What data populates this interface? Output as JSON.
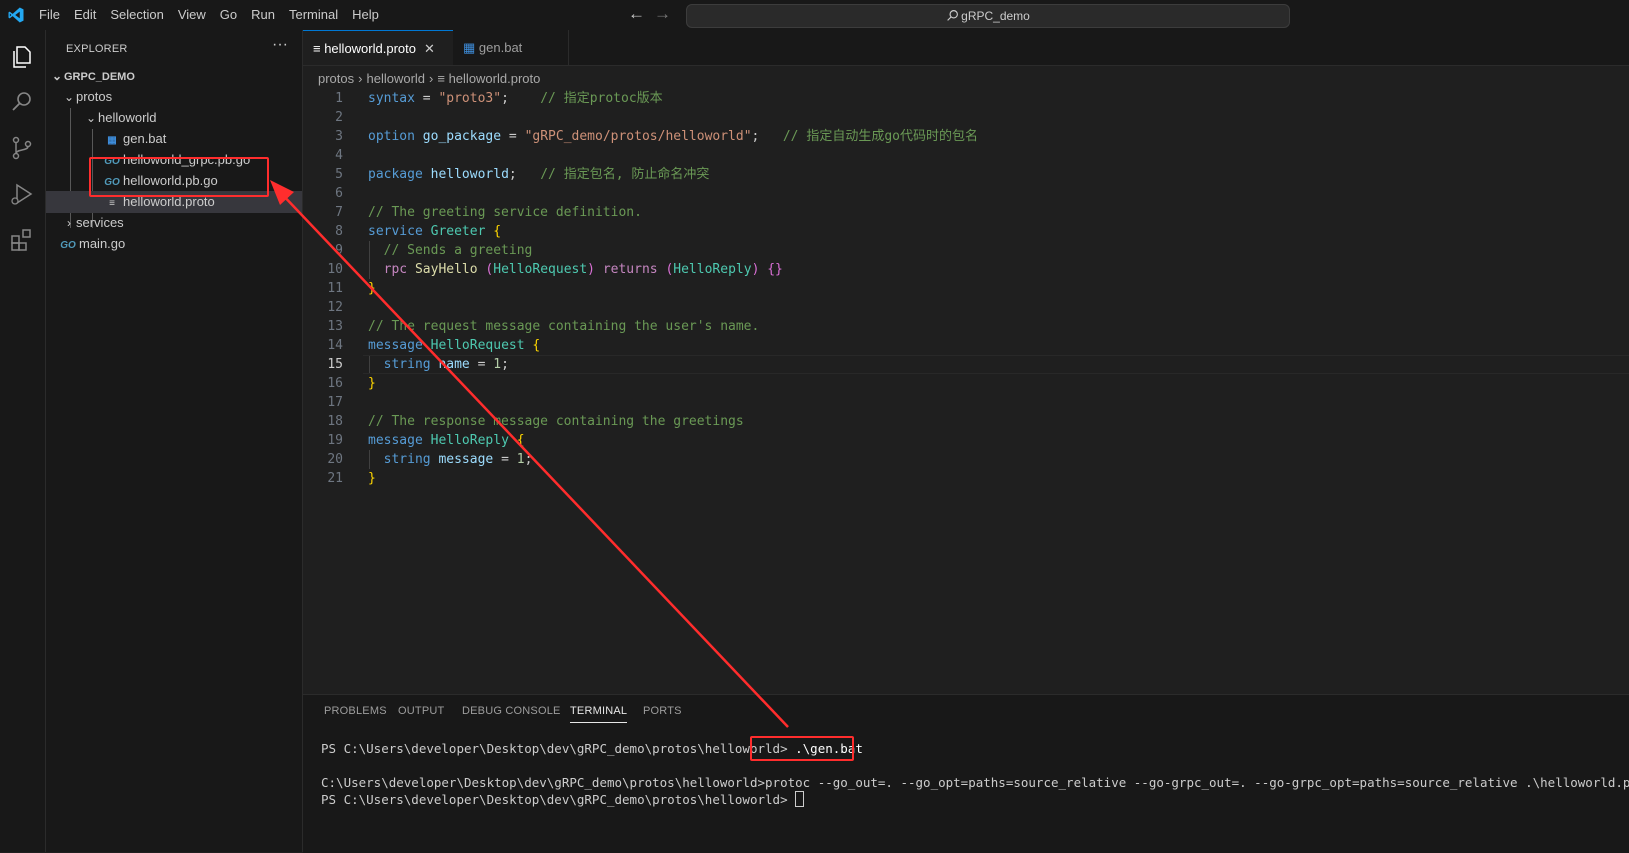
{
  "menu": [
    "File",
    "Edit",
    "Selection",
    "View",
    "Go",
    "Run",
    "Terminal",
    "Help"
  ],
  "search": {
    "text": "gRPC_demo"
  },
  "explorer": {
    "title": "EXPLORER",
    "more_label": "···",
    "tree": [
      {
        "label": "GRPC_DEMO",
        "type": "root",
        "expanded": true,
        "depth": 0
      },
      {
        "label": "protos",
        "type": "folder",
        "expanded": true,
        "depth": 1
      },
      {
        "label": "helloworld",
        "type": "folder",
        "expanded": true,
        "depth": 2
      },
      {
        "label": "gen.bat",
        "type": "bat",
        "depth": 3
      },
      {
        "label": "helloworld_grpc.pb.go",
        "type": "go",
        "depth": 3
      },
      {
        "label": "helloworld.pb.go",
        "type": "go",
        "depth": 3
      },
      {
        "label": "helloworld.proto",
        "type": "proto",
        "depth": 3,
        "selected": true
      },
      {
        "label": "services",
        "type": "folder",
        "expanded": false,
        "depth": 1
      },
      {
        "label": "main.go",
        "type": "go",
        "depth": 1
      }
    ]
  },
  "tabs": [
    {
      "label": "helloworld.proto",
      "active": true,
      "close": "✕"
    },
    {
      "label": "gen.bat",
      "active": false
    }
  ],
  "breadcrumb": [
    "protos",
    "helloworld",
    "helloworld.proto"
  ],
  "editor": {
    "current_line": 15,
    "lines": [
      {
        "n": "1",
        "tokens": [
          [
            "kw2",
            "syntax"
          ],
          [
            "plain",
            " = "
          ],
          [
            "str",
            "\"proto3\""
          ],
          [
            "plain",
            ";    "
          ],
          [
            "cmt",
            "// 指定protoc版本"
          ]
        ]
      },
      {
        "n": "2",
        "tokens": []
      },
      {
        "n": "3",
        "tokens": [
          [
            "kw2",
            "option"
          ],
          [
            "plain",
            " "
          ],
          [
            "var",
            "go_package"
          ],
          [
            "plain",
            " = "
          ],
          [
            "str",
            "\"gRPC_demo/protos/helloworld\""
          ],
          [
            "plain",
            ";   "
          ],
          [
            "cmt",
            "// 指定自动生成go代码时的包名"
          ]
        ]
      },
      {
        "n": "4",
        "tokens": []
      },
      {
        "n": "5",
        "tokens": [
          [
            "kw2",
            "package"
          ],
          [
            "plain",
            " "
          ],
          [
            "var",
            "helloworld"
          ],
          [
            "plain",
            ";   "
          ],
          [
            "cmt",
            "// 指定包名, 防止命名冲突"
          ]
        ]
      },
      {
        "n": "6",
        "tokens": []
      },
      {
        "n": "7",
        "tokens": [
          [
            "cmt",
            "// The greeting service definition."
          ]
        ]
      },
      {
        "n": "8",
        "tokens": [
          [
            "kw2",
            "service"
          ],
          [
            "plain",
            " "
          ],
          [
            "ty",
            "Greeter"
          ],
          [
            "plain",
            " "
          ],
          [
            "br1",
            "{"
          ]
        ]
      },
      {
        "n": "9",
        "tokens": [
          [
            "plain",
            "  "
          ],
          [
            "cmt",
            "// Sends a greeting"
          ]
        ]
      },
      {
        "n": "10",
        "tokens": [
          [
            "plain",
            "  "
          ],
          [
            "kw",
            "rpc"
          ],
          [
            "plain",
            " "
          ],
          [
            "fn",
            "SayHello"
          ],
          [
            "plain",
            " "
          ],
          [
            "br2",
            "("
          ],
          [
            "ty",
            "HelloRequest"
          ],
          [
            "br2",
            ")"
          ],
          [
            "plain",
            " "
          ],
          [
            "kw",
            "returns"
          ],
          [
            "plain",
            " "
          ],
          [
            "br2",
            "("
          ],
          [
            "ty",
            "HelloReply"
          ],
          [
            "br2",
            ")"
          ],
          [
            "plain",
            " "
          ],
          [
            "br2",
            "{}"
          ]
        ]
      },
      {
        "n": "11",
        "tokens": [
          [
            "br1",
            "}"
          ]
        ]
      },
      {
        "n": "12",
        "tokens": []
      },
      {
        "n": "13",
        "tokens": [
          [
            "cmt",
            "// The request message containing the user's name."
          ]
        ]
      },
      {
        "n": "14",
        "tokens": [
          [
            "kw2",
            "message"
          ],
          [
            "plain",
            " "
          ],
          [
            "ty",
            "HelloRequest"
          ],
          [
            "plain",
            " "
          ],
          [
            "br1",
            "{"
          ]
        ]
      },
      {
        "n": "15",
        "tokens": [
          [
            "plain",
            "  "
          ],
          [
            "kw2",
            "string"
          ],
          [
            "plain",
            " "
          ],
          [
            "var",
            "name"
          ],
          [
            "plain",
            " = "
          ],
          [
            "num",
            "1"
          ],
          [
            "plain",
            ";"
          ]
        ]
      },
      {
        "n": "16",
        "tokens": [
          [
            "br1",
            "}"
          ]
        ]
      },
      {
        "n": "17",
        "tokens": []
      },
      {
        "n": "18",
        "tokens": [
          [
            "cmt",
            "// The response message containing the greetings"
          ]
        ]
      },
      {
        "n": "19",
        "tokens": [
          [
            "kw2",
            "message"
          ],
          [
            "plain",
            " "
          ],
          [
            "ty",
            "HelloReply"
          ],
          [
            "plain",
            " "
          ],
          [
            "br1",
            "{"
          ]
        ]
      },
      {
        "n": "20",
        "tokens": [
          [
            "plain",
            "  "
          ],
          [
            "kw2",
            "string"
          ],
          [
            "plain",
            " "
          ],
          [
            "var",
            "message"
          ],
          [
            "plain",
            " = "
          ],
          [
            "num",
            "1"
          ],
          [
            "plain",
            ";"
          ]
        ]
      },
      {
        "n": "21",
        "tokens": [
          [
            "br1",
            "}"
          ]
        ]
      }
    ]
  },
  "panel": {
    "tabs": [
      "PROBLEMS",
      "OUTPUT",
      "DEBUG CONSOLE",
      "TERMINAL",
      "PORTS"
    ],
    "active_tab": "TERMINAL",
    "terminal": {
      "prompt1": "PS C:\\Users\\developer\\Desktop\\dev\\gRPC_demo\\protos\\helloworld>",
      "command1": " .\\gen.bat",
      "output1": "C:\\Users\\developer\\Desktop\\dev\\gRPC_demo\\protos\\helloworld>protoc --go_out=. --go_opt=paths=source_relative --go-grpc_out=. --go-grpc_opt=paths=source_relative .\\helloworld.proto",
      "prompt2": "PS C:\\Users\\developer\\Desktop\\dev\\gRPC_demo\\protos\\helloworld>"
    }
  },
  "colors": {
    "accent": "#0078d4",
    "annotation": "#ff2d2d"
  }
}
